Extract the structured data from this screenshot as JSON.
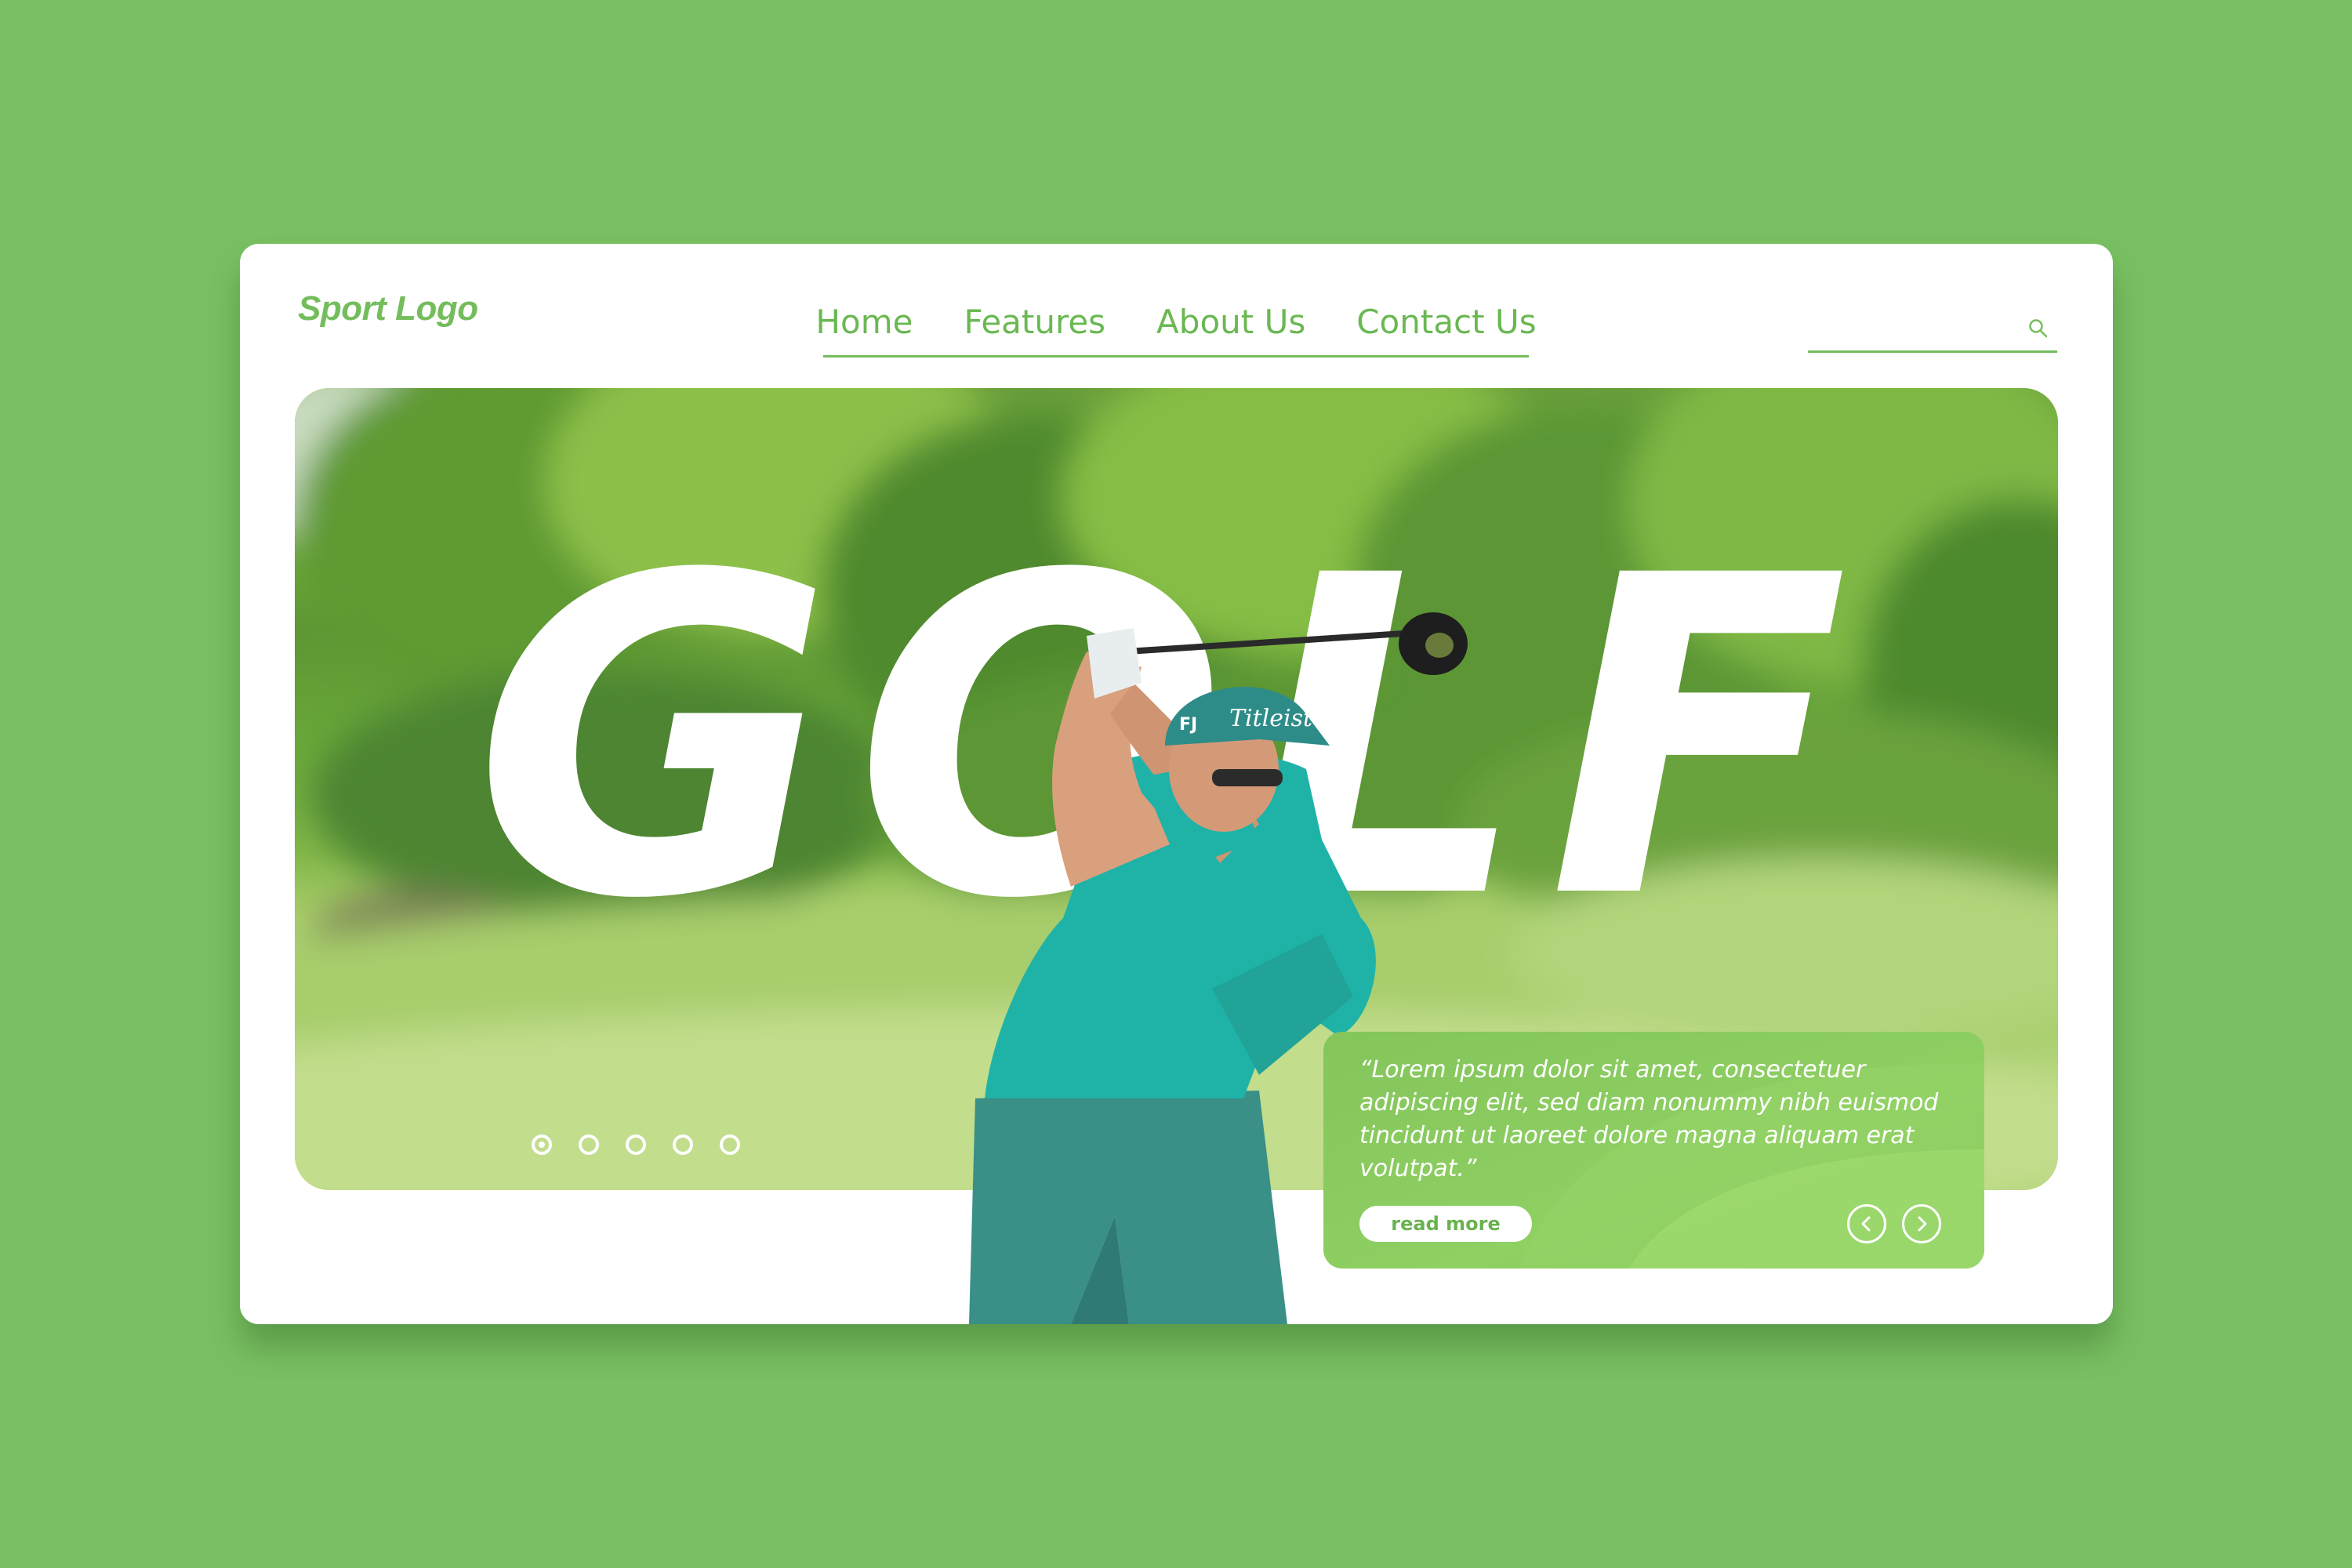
{
  "header": {
    "logo": "Sport Logo",
    "nav": [
      {
        "label": "Home"
      },
      {
        "label": "Features"
      },
      {
        "label": "About Us"
      },
      {
        "label": "Contact Us"
      }
    ],
    "search": {
      "placeholder": "",
      "icon": "search-icon"
    }
  },
  "hero": {
    "title": "GOLF",
    "slides": {
      "count": 5,
      "active": 1
    },
    "quote": "“Lorem ipsum dolor sit amet, consectetuer adipiscing elit, sed diam nonummy nibh euismod tincidunt ut laoreet dolore magna aliquam erat volutpat.”",
    "read_more": "read more",
    "prev_icon": "chevron-left-icon",
    "next_icon": "chevron-right-icon"
  },
  "colors": {
    "background": "#79c062",
    "accent": "#74bd5c",
    "card": "#ffffff"
  }
}
